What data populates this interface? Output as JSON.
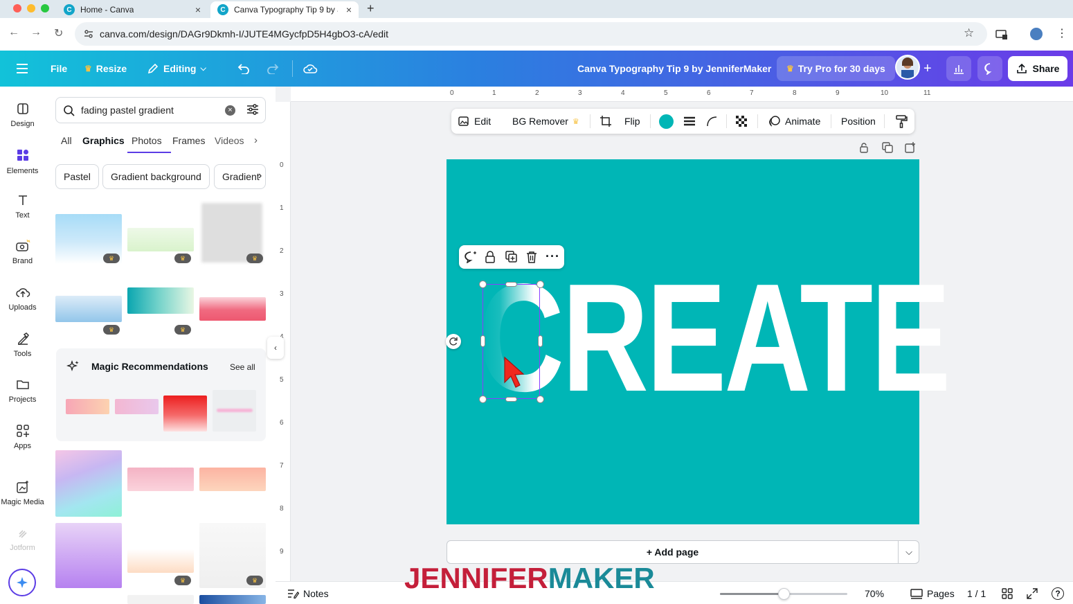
{
  "browser": {
    "tabs": [
      {
        "title": "Home - Canva",
        "active": false
      },
      {
        "title": "Canva Typography Tip 9 by J",
        "active": true
      }
    ],
    "url": "canva.com/design/DAGr9Dkmh-I/JUTE4MGycfpD5H4gbO3-cA/edit"
  },
  "header": {
    "file": "File",
    "resize": "Resize",
    "editing": "Editing",
    "doc_title": "Canva Typography Tip 9 by JenniferMaker",
    "try_pro": "Try Pro for 30 days",
    "share": "Share",
    "gradient_start": "#12c2d9",
    "gradient_end": "#6b3be8"
  },
  "rail": [
    {
      "label": "Design",
      "icon": "design-icon"
    },
    {
      "label": "Elements",
      "icon": "elements-icon",
      "active": true
    },
    {
      "label": "Text",
      "icon": "text-icon"
    },
    {
      "label": "Brand",
      "icon": "brand-icon"
    },
    {
      "label": "Uploads",
      "icon": "uploads-icon"
    },
    {
      "label": "Tools",
      "icon": "tools-icon"
    },
    {
      "label": "Projects",
      "icon": "projects-icon"
    },
    {
      "label": "Apps",
      "icon": "apps-icon"
    },
    {
      "label": "Magic Media",
      "icon": "magic-media-icon"
    },
    {
      "label": "Jotform",
      "icon": "jotform-icon"
    }
  ],
  "panel": {
    "search_value": "fading pastel gradient",
    "tabs": [
      "All",
      "Graphics",
      "Photos",
      "Frames",
      "Videos"
    ],
    "active_tab": "Graphics",
    "chips": [
      "Pastel",
      "Gradient background",
      "Gradient"
    ],
    "magic_title": "Magic Recommendations",
    "see_all": "See all"
  },
  "ruler": {
    "top": [
      "0",
      "1",
      "2",
      "3",
      "4",
      "5",
      "6",
      "7",
      "8",
      "9",
      "10",
      "11"
    ],
    "left": [
      "0",
      "1",
      "2",
      "3",
      "4",
      "5",
      "6",
      "7",
      "8",
      "9"
    ]
  },
  "context_toolbar": {
    "edit": "Edit",
    "bg_remover": "BG Remover",
    "flip": "Flip",
    "animate": "Animate",
    "position": "Position",
    "color": "#00b6b6"
  },
  "canvas": {
    "background": "#00b6b6",
    "headline": "CREATE",
    "add_page": "+ Add page"
  },
  "bottom": {
    "notes": "Notes",
    "zoom": "70%",
    "zoom_fraction": 0.5,
    "pages": "Pages",
    "page_count": "1 / 1"
  },
  "watermark": {
    "part1": "JENNIFER",
    "part2": "MAKER",
    "color1": "#c41f3a",
    "color2": "#1a8a98"
  }
}
